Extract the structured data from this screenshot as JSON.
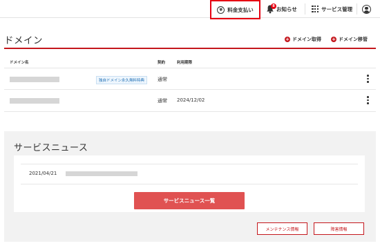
{
  "topbar": {
    "payment_label": "料金支払い",
    "notice_label": "お知らせ",
    "notice_count": "8",
    "service_label": "サービス管理",
    "yen_glyph": "¥"
  },
  "domain": {
    "title": "ドメイン",
    "acquire_label": "ドメイン取得",
    "transfer_label": "ドメイン移管",
    "columns": {
      "name": "ドメイン名",
      "contract": "契約",
      "expiry": "利用期限"
    },
    "rows": [
      {
        "tag": "独自ドメイン永久無料特典",
        "contract": "通常",
        "expiry": ""
      },
      {
        "tag": "",
        "contract": "通常",
        "expiry": "2024/12/02"
      }
    ]
  },
  "news": {
    "title": "サービスニュース",
    "items": [
      {
        "date": "2021/04/21"
      }
    ],
    "list_button": "サービスニュース一覧",
    "maintenance_button": "メンテナンス情報",
    "fault_button": "障害情報"
  },
  "colors": {
    "accent_red": "#c4161c",
    "highlight_red": "#e60012",
    "news_button": "#e05252",
    "tag_blue": "#1f6fb5"
  },
  "icons": [
    "yen-icon",
    "bell-icon",
    "grid-icon",
    "account-icon",
    "plus-circle-icon",
    "kebab-menu-icon"
  ]
}
